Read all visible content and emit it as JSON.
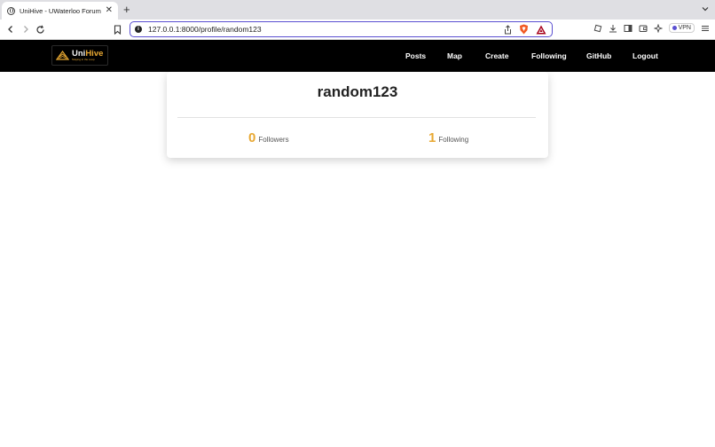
{
  "browser": {
    "tab_title": "UniHive - UWaterloo Forum",
    "tab_close": "✕",
    "new_tab": "+",
    "url": "127.0.0.1:8000/profile/random123",
    "url_info": "i",
    "vpn_label": "VPN"
  },
  "site": {
    "logo_name_prefix": "Uni",
    "logo_name_suffix": "Hive",
    "logo_tagline": "Staying in the Loop",
    "nav": {
      "posts": "Posts",
      "map": "Map",
      "create": "Create",
      "following": "Following",
      "github": "GitHub",
      "logout": "Logout"
    }
  },
  "profile": {
    "username": "random123",
    "followers_count": "0",
    "followers_label": "Followers",
    "following_count": "1",
    "following_label": "Following"
  },
  "colors": {
    "accent": "#e8a832",
    "nav_bg": "#000000",
    "url_border": "#5a4fd1"
  }
}
